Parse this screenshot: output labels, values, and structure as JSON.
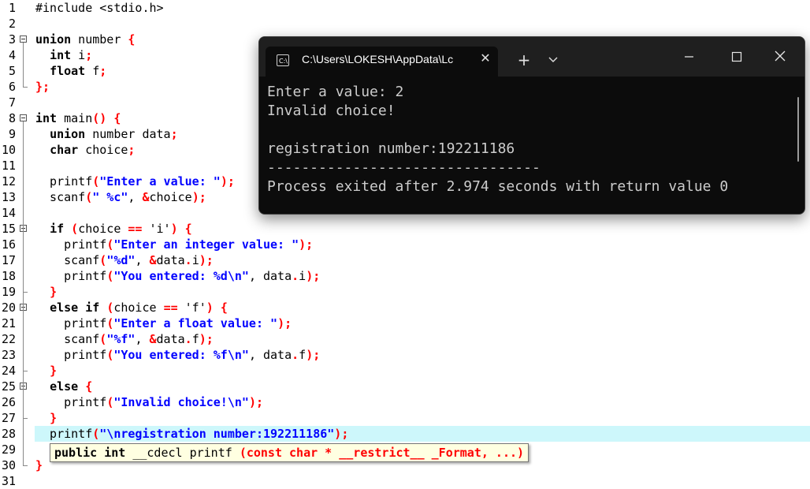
{
  "editor": {
    "lines": [
      {
        "n": "1",
        "code": [
          {
            "t": "#include <stdio.h>",
            "c": ""
          }
        ]
      },
      {
        "n": "2",
        "code": []
      },
      {
        "n": "3",
        "fold": "open",
        "code": [
          {
            "t": "union",
            "c": "kw"
          },
          {
            "t": " number ",
            "c": ""
          },
          {
            "t": "{",
            "c": "sym"
          }
        ]
      },
      {
        "n": "4",
        "code": [
          {
            "t": "  ",
            "c": ""
          },
          {
            "t": "int",
            "c": "kw"
          },
          {
            "t": " i",
            "c": ""
          },
          {
            "t": ";",
            "c": "sym"
          }
        ]
      },
      {
        "n": "5",
        "code": [
          {
            "t": "  ",
            "c": ""
          },
          {
            "t": "float",
            "c": "kw"
          },
          {
            "t": " f",
            "c": ""
          },
          {
            "t": ";",
            "c": "sym"
          }
        ]
      },
      {
        "n": "6",
        "fold": "end",
        "code": [
          {
            "t": "};",
            "c": "sym"
          }
        ]
      },
      {
        "n": "7",
        "code": []
      },
      {
        "n": "8",
        "fold": "open",
        "code": [
          {
            "t": "int",
            "c": "kw"
          },
          {
            "t": " main",
            "c": ""
          },
          {
            "t": "()",
            "c": "sym"
          },
          {
            "t": " ",
            "c": ""
          },
          {
            "t": "{",
            "c": "sym"
          }
        ]
      },
      {
        "n": "9",
        "code": [
          {
            "t": "  ",
            "c": ""
          },
          {
            "t": "union",
            "c": "kw"
          },
          {
            "t": " number data",
            "c": ""
          },
          {
            "t": ";",
            "c": "sym"
          }
        ]
      },
      {
        "n": "10",
        "code": [
          {
            "t": "  ",
            "c": ""
          },
          {
            "t": "char",
            "c": "kw"
          },
          {
            "t": " choice",
            "c": ""
          },
          {
            "t": ";",
            "c": "sym"
          }
        ]
      },
      {
        "n": "11",
        "code": []
      },
      {
        "n": "12",
        "code": [
          {
            "t": "  printf",
            "c": ""
          },
          {
            "t": "(",
            "c": "sym"
          },
          {
            "t": "\"Enter a value: \"",
            "c": "str"
          },
          {
            "t": ");",
            "c": "sym"
          }
        ]
      },
      {
        "n": "13",
        "code": [
          {
            "t": "  scanf",
            "c": ""
          },
          {
            "t": "(",
            "c": "sym"
          },
          {
            "t": "\" %c\"",
            "c": "str"
          },
          {
            "t": ", ",
            "c": ""
          },
          {
            "t": "&",
            "c": "sym"
          },
          {
            "t": "choice",
            "c": ""
          },
          {
            "t": ");",
            "c": "sym"
          }
        ]
      },
      {
        "n": "14",
        "code": []
      },
      {
        "n": "15",
        "fold": "open",
        "code": [
          {
            "t": "  ",
            "c": ""
          },
          {
            "t": "if",
            "c": "kw"
          },
          {
            "t": " ",
            "c": ""
          },
          {
            "t": "(",
            "c": "sym"
          },
          {
            "t": "choice ",
            "c": ""
          },
          {
            "t": "==",
            "c": "sym"
          },
          {
            "t": " 'i'",
            "c": ""
          },
          {
            "t": ")",
            "c": "sym"
          },
          {
            "t": " ",
            "c": ""
          },
          {
            "t": "{",
            "c": "sym"
          }
        ]
      },
      {
        "n": "16",
        "code": [
          {
            "t": "    printf",
            "c": ""
          },
          {
            "t": "(",
            "c": "sym"
          },
          {
            "t": "\"Enter an integer value: \"",
            "c": "str"
          },
          {
            "t": ");",
            "c": "sym"
          }
        ]
      },
      {
        "n": "17",
        "code": [
          {
            "t": "    scanf",
            "c": ""
          },
          {
            "t": "(",
            "c": "sym"
          },
          {
            "t": "\"%d\"",
            "c": "str"
          },
          {
            "t": ", ",
            "c": ""
          },
          {
            "t": "&",
            "c": "sym"
          },
          {
            "t": "data",
            "c": ""
          },
          {
            "t": ".",
            "c": "sym"
          },
          {
            "t": "i",
            "c": ""
          },
          {
            "t": ");",
            "c": "sym"
          }
        ]
      },
      {
        "n": "18",
        "code": [
          {
            "t": "    printf",
            "c": ""
          },
          {
            "t": "(",
            "c": "sym"
          },
          {
            "t": "\"You entered: %d\\n\"",
            "c": "str"
          },
          {
            "t": ", data",
            "c": ""
          },
          {
            "t": ".",
            "c": "sym"
          },
          {
            "t": "i",
            "c": ""
          },
          {
            "t": ");",
            "c": "sym"
          }
        ]
      },
      {
        "n": "19",
        "fold": "end",
        "code": [
          {
            "t": "  ",
            "c": ""
          },
          {
            "t": "}",
            "c": "sym"
          }
        ]
      },
      {
        "n": "20",
        "fold": "open",
        "code": [
          {
            "t": "  ",
            "c": ""
          },
          {
            "t": "else if",
            "c": "kw"
          },
          {
            "t": " ",
            "c": ""
          },
          {
            "t": "(",
            "c": "sym"
          },
          {
            "t": "choice ",
            "c": ""
          },
          {
            "t": "==",
            "c": "sym"
          },
          {
            "t": " 'f'",
            "c": ""
          },
          {
            "t": ")",
            "c": "sym"
          },
          {
            "t": " ",
            "c": ""
          },
          {
            "t": "{",
            "c": "sym"
          }
        ]
      },
      {
        "n": "21",
        "code": [
          {
            "t": "    printf",
            "c": ""
          },
          {
            "t": "(",
            "c": "sym"
          },
          {
            "t": "\"Enter a float value: \"",
            "c": "str"
          },
          {
            "t": ");",
            "c": "sym"
          }
        ]
      },
      {
        "n": "22",
        "code": [
          {
            "t": "    scanf",
            "c": ""
          },
          {
            "t": "(",
            "c": "sym"
          },
          {
            "t": "\"%f\"",
            "c": "str"
          },
          {
            "t": ", ",
            "c": ""
          },
          {
            "t": "&",
            "c": "sym"
          },
          {
            "t": "data",
            "c": ""
          },
          {
            "t": ".",
            "c": "sym"
          },
          {
            "t": "f",
            "c": ""
          },
          {
            "t": ");",
            "c": "sym"
          }
        ]
      },
      {
        "n": "23",
        "code": [
          {
            "t": "    printf",
            "c": ""
          },
          {
            "t": "(",
            "c": "sym"
          },
          {
            "t": "\"You entered: %f\\n\"",
            "c": "str"
          },
          {
            "t": ", data",
            "c": ""
          },
          {
            "t": ".",
            "c": "sym"
          },
          {
            "t": "f",
            "c": ""
          },
          {
            "t": ");",
            "c": "sym"
          }
        ]
      },
      {
        "n": "24",
        "fold": "end",
        "code": [
          {
            "t": "  ",
            "c": ""
          },
          {
            "t": "}",
            "c": "sym"
          }
        ]
      },
      {
        "n": "25",
        "fold": "open",
        "code": [
          {
            "t": "  ",
            "c": ""
          },
          {
            "t": "else",
            "c": "kw"
          },
          {
            "t": " ",
            "c": ""
          },
          {
            "t": "{",
            "c": "sym"
          }
        ]
      },
      {
        "n": "26",
        "code": [
          {
            "t": "    printf",
            "c": ""
          },
          {
            "t": "(",
            "c": "sym"
          },
          {
            "t": "\"Invalid choice!\\n\"",
            "c": "str"
          },
          {
            "t": ");",
            "c": "sym"
          }
        ]
      },
      {
        "n": "27",
        "fold": "end",
        "code": [
          {
            "t": "  ",
            "c": ""
          },
          {
            "t": "}",
            "c": "sym"
          }
        ]
      },
      {
        "n": "28",
        "highlight": true,
        "code": [
          {
            "t": "  printf",
            "c": ""
          },
          {
            "t": "(",
            "c": "sym"
          },
          {
            "t": "\"\\nregistration number:192211186\"",
            "c": "str"
          },
          {
            "t": ");",
            "c": "sym"
          }
        ]
      },
      {
        "n": "29",
        "code": []
      },
      {
        "n": "30",
        "fold": "end",
        "code": [
          {
            "t": "}",
            "c": "sym"
          }
        ]
      },
      {
        "n": "31",
        "code": []
      }
    ],
    "tooltip": {
      "kw1": "public int",
      "mid": " __cdecl printf ",
      "red": "(const char * __restrict__ _Format, ...)"
    }
  },
  "terminal": {
    "tab_icon": "C:\\",
    "tab_title": "C:\\Users\\LOKESH\\AppData\\Lc",
    "tab_close": "✕",
    "new_tab": "+",
    "output": [
      "Enter a value: 2",
      "Invalid choice!",
      "",
      "registration number:192211186",
      "--------------------------------",
      "Process exited after 2.974 seconds with return value 0"
    ]
  }
}
